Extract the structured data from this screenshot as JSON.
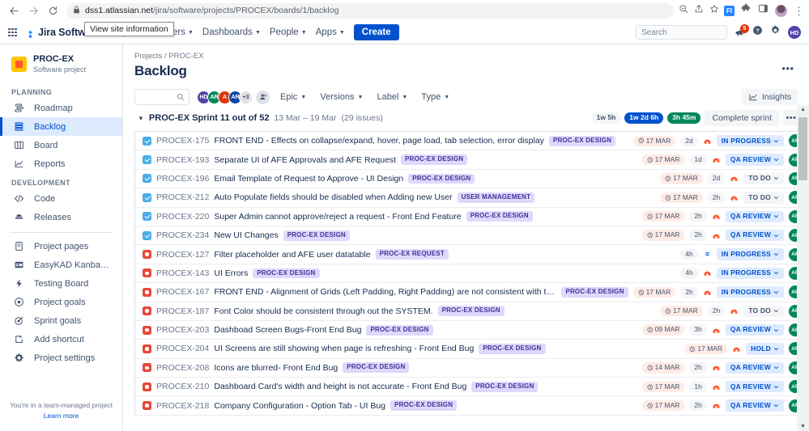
{
  "browser": {
    "back_icon": "back-arrow-icon",
    "forward_icon": "forward-arrow-icon",
    "reload_icon": "reload-icon",
    "url_domain": "dss1.atlassian.net",
    "url_path": "/jira/software/projects/PROCEX/boards/1/backlog",
    "tooltip": "View site information",
    "extension_label": "FI",
    "kebab": "⋮"
  },
  "jira_nav": {
    "product_name": "Jira Software",
    "items": [
      {
        "label": "Projects",
        "caret": true
      },
      {
        "label": "Filters",
        "caret": true
      },
      {
        "label": "Dashboards",
        "caret": true
      },
      {
        "label": "People",
        "caret": true
      },
      {
        "label": "Apps",
        "caret": true
      }
    ],
    "create_label": "Create",
    "search_placeholder": "Search",
    "notification_count": "5",
    "user_initials": "HD"
  },
  "sidebar": {
    "project_name": "PROC-EX",
    "project_type": "Software project",
    "section_planning": "PLANNING",
    "section_development": "DEVELOPMENT",
    "planning_items": [
      {
        "label": "Roadmap",
        "icon": "roadmap-icon",
        "active": false
      },
      {
        "label": "Backlog",
        "icon": "backlog-icon",
        "active": true
      },
      {
        "label": "Board",
        "icon": "board-icon",
        "active": false
      },
      {
        "label": "Reports",
        "icon": "reports-icon",
        "active": false
      }
    ],
    "development_items": [
      {
        "label": "Code",
        "icon": "code-icon",
        "active": false
      },
      {
        "label": "Releases",
        "icon": "releases-icon",
        "active": false
      }
    ],
    "other_items": [
      {
        "label": "Project pages",
        "icon": "page-icon",
        "active": false
      },
      {
        "label": "EasyKAD Kanban Boa...",
        "icon": "kanban-icon",
        "active": false
      },
      {
        "label": "Testing Board",
        "icon": "lightning-icon",
        "active": false
      },
      {
        "label": "Project goals",
        "icon": "target-circle-icon",
        "active": false
      },
      {
        "label": "Sprint goals",
        "icon": "dart-icon",
        "active": false
      },
      {
        "label": "Add shortcut",
        "icon": "add-shortcut-icon",
        "active": false
      },
      {
        "label": "Project settings",
        "icon": "gear-icon",
        "active": false
      }
    ],
    "footer_note": "You're in a team-managed project",
    "footer_link": "Learn more"
  },
  "header": {
    "breadcrumb_projects": "Projects",
    "breadcrumb_sep": "/",
    "breadcrumb_project": "PROC-EX",
    "title": "Backlog",
    "more_label": "•••"
  },
  "filters": {
    "search_placeholder": "",
    "avatars": [
      {
        "initials": "HD",
        "color": "#5243aa"
      },
      {
        "initials": "AR",
        "color": "#00875a"
      },
      {
        "initials": "A",
        "color": "#de350b"
      },
      {
        "initials": "AR",
        "color": "#0747a6"
      },
      {
        "initials": "+3",
        "color": "#dfe1e6",
        "text_color": "#42526e"
      }
    ],
    "dropdowns": [
      {
        "label": "Epic"
      },
      {
        "label": "Versions"
      },
      {
        "label": "Label"
      },
      {
        "label": "Type"
      }
    ],
    "insights_label": "Insights"
  },
  "sprint": {
    "name": "PROC-EX Sprint 11 out of 52",
    "dates": "13 Mar – 19 Mar",
    "issue_count": "(29 issues)",
    "estimate_grey": "1w 5h",
    "estimate_blue": "1w 2d 6h",
    "estimate_green": "3h 45m",
    "complete_label": "Complete sprint",
    "kebab": "•••"
  },
  "issues": [
    {
      "type": "task",
      "key": "PROCEX-175",
      "summary": "FRONT END - Effects on collapse/expand, hover, page load, tab selection, error display",
      "epic": "PROC-EX DESIGN",
      "due": "17 MAR",
      "estimate": "2d",
      "priority": "high",
      "status": "IN PROGRESS",
      "status_kind": "blue",
      "assignee": "AR"
    },
    {
      "type": "task",
      "key": "PROCEX-193",
      "summary": "Separate UI of AFE Approvals and AFE Request",
      "epic": "PROC-EX DESIGN",
      "due": "17 MAR",
      "estimate": "1d",
      "priority": "high",
      "status": "QA REVIEW",
      "status_kind": "blue",
      "assignee": "AR"
    },
    {
      "type": "task",
      "key": "PROCEX-196",
      "summary": "Email Template of Request to Approve - UI Design",
      "epic": "PROC-EX DESIGN",
      "due": "17 MAR",
      "estimate": "2d",
      "priority": "high",
      "status": "TO DO",
      "status_kind": "todo",
      "assignee": "AR"
    },
    {
      "type": "task",
      "key": "PROCEX-212",
      "summary": "Auto Populate fields should be disabled when Adding new User",
      "epic": "USER MANAGEMENT",
      "due": "17 MAR",
      "estimate": "2h",
      "priority": "high",
      "status": "TO DO",
      "status_kind": "todo",
      "assignee": "AR"
    },
    {
      "type": "task",
      "key": "PROCEX-220",
      "summary": "Super Admin cannot approve/reject a request - Front End Feature",
      "epic": "PROC-EX DESIGN",
      "due": "17 MAR",
      "estimate": "2h",
      "priority": "high",
      "status": "QA REVIEW",
      "status_kind": "blue",
      "assignee": "AR"
    },
    {
      "type": "task",
      "key": "PROCEX-234",
      "summary": "New UI Changes",
      "epic": "PROC-EX DESIGN",
      "due": "17 MAR",
      "estimate": "2h",
      "priority": "high",
      "status": "QA REVIEW",
      "status_kind": "blue",
      "assignee": "AR"
    },
    {
      "type": "bug",
      "key": "PROCEX-127",
      "summary": "Filter placeholder and AFE user datatable",
      "epic": "PROC-EX REQUEST",
      "due": "",
      "estimate": "4h",
      "priority": "low",
      "status": "IN PROGRESS",
      "status_kind": "blue",
      "assignee": "AR"
    },
    {
      "type": "bug",
      "key": "PROCEX-143",
      "summary": "UI Errors",
      "epic": "PROC-EX DESIGN",
      "due": "",
      "estimate": "4h",
      "priority": "high",
      "status": "IN PROGRESS",
      "status_kind": "blue",
      "assignee": "AR"
    },
    {
      "type": "bug",
      "key": "PROCEX-167",
      "summary": "FRONT END - Alignment of Grids (Left Padding, Right Padding) are not consistent with the Software",
      "epic": "PROC-EX DESIGN",
      "due": "17 MAR",
      "estimate": "2h",
      "priority": "high",
      "status": "IN PROGRESS",
      "status_kind": "blue",
      "assignee": "AR"
    },
    {
      "type": "bug",
      "key": "PROCEX-187",
      "summary": "Font Color should be consistent through out the SYSTEM.",
      "epic": "PROC-EX DESIGN",
      "due": "17 MAR",
      "estimate": "2h",
      "priority": "high",
      "status": "TO DO",
      "status_kind": "todo",
      "assignee": "AR"
    },
    {
      "type": "bug",
      "key": "PROCEX-203",
      "summary": "Dashboad Screen Bugs-Front End Bug",
      "epic": "PROC-EX DESIGN",
      "due": "09 MAR",
      "estimate": "3h",
      "priority": "high",
      "status": "QA REVIEW",
      "status_kind": "blue",
      "assignee": "AR"
    },
    {
      "type": "bug",
      "key": "PROCEX-204",
      "summary": "UI Screens are still showing when page is refreshing - Front End Bug",
      "epic": "PROC-EX DESIGN",
      "due": "17 MAR",
      "estimate": "",
      "priority": "high",
      "status": "HOLD",
      "status_kind": "blue",
      "assignee": "AR"
    },
    {
      "type": "bug",
      "key": "PROCEX-208",
      "summary": "Icons are blurred- Front End Bug",
      "epic": "PROC-EX DESIGN",
      "due": "14 MAR",
      "estimate": "2h",
      "priority": "high",
      "status": "QA REVIEW",
      "status_kind": "blue",
      "assignee": "AR"
    },
    {
      "type": "bug",
      "key": "PROCEX-210",
      "summary": "Dashboard Card's width and height is not accurate - Front End Bug",
      "epic": "PROC-EX DESIGN",
      "due": "17 MAR",
      "estimate": "1h",
      "priority": "high",
      "status": "QA REVIEW",
      "status_kind": "blue",
      "assignee": "AR"
    },
    {
      "type": "bug",
      "key": "PROCEX-218",
      "summary": "Company Configuration - Option Tab - UI Bug",
      "epic": "PROC-EX DESIGN",
      "due": "17 MAR",
      "estimate": "2h",
      "priority": "high",
      "status": "QA REVIEW",
      "status_kind": "blue",
      "assignee": "AR"
    }
  ]
}
